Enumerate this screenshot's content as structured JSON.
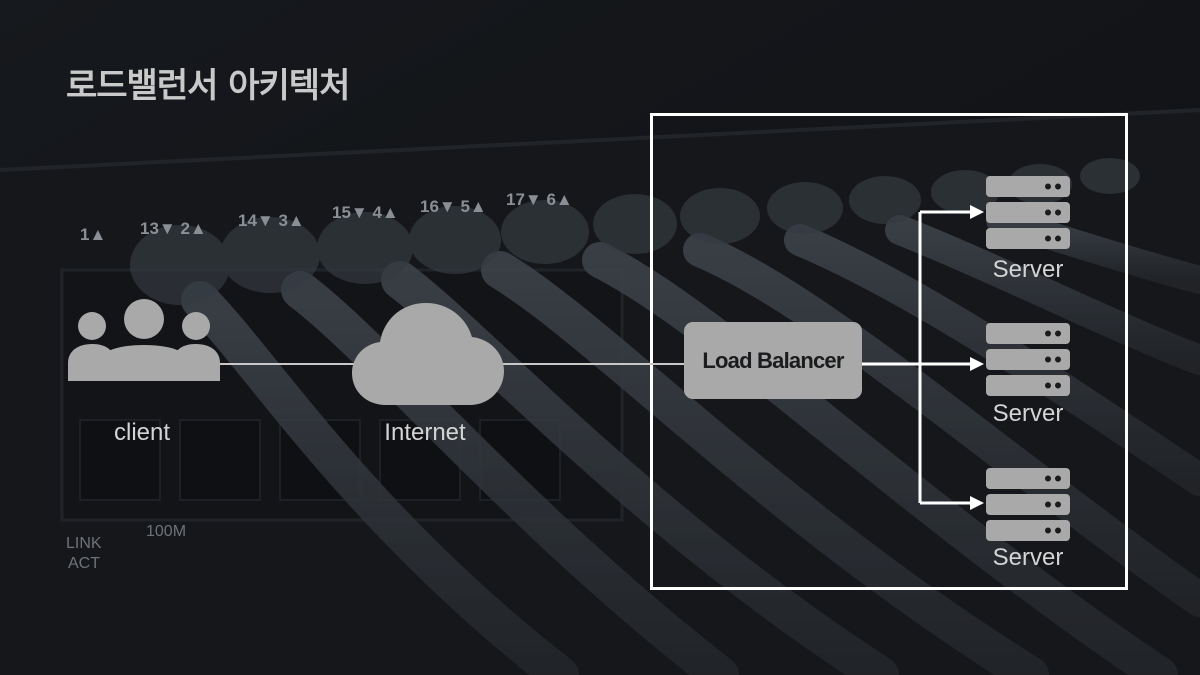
{
  "title": "로드밸런서 아키텍처",
  "background": {
    "port_labels": [
      "1▲",
      "13▼ 2▲",
      "14▼ 3▲",
      "15▼ 4▲",
      "16▼ 5▲",
      "17▼ 6▲"
    ],
    "link_label_line1": "LINK",
    "link_label_line2": "ACT",
    "speed_label": "100M"
  },
  "nodes": {
    "client": "client",
    "internet": "Internet",
    "load_balancer": "Load Balancer",
    "servers": [
      "Server",
      "Server",
      "Server"
    ]
  },
  "colors": {
    "icon": "#a9a9a9",
    "frame": "#ffffff",
    "line": "#ffffff"
  }
}
